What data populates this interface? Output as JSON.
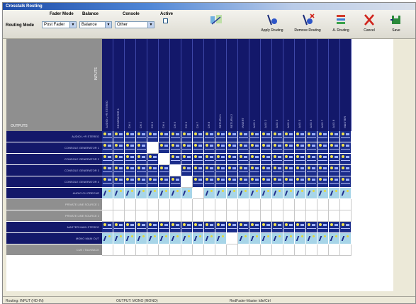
{
  "window": {
    "title": "Crosstalk Routing"
  },
  "toolbar": {
    "routing_mode_label": "Routing Mode",
    "fader_mode_label": "Fader Mode",
    "fader_mode_value": "Post Fader",
    "balance_label": "Balance",
    "balance_value": "Balance",
    "console_label": "Console",
    "console_value": "Other",
    "active_label": "Active",
    "apply_label": "Apply Routing",
    "remove_label": "Remove Routing",
    "arouting_label": "A. Routing",
    "cancel_label": "Cancel",
    "save_label": "Save"
  },
  "grid": {
    "corner_vertical_label": "INPUTS",
    "corner_outputs_label": "OUTPUTS",
    "columns": [
      "AUDIO L+R  STEREO",
      "GENERATOR 1",
      "CH 1",
      "CH 2",
      "CH 3",
      "CH 4",
      "CH 5",
      "CH 6",
      "CH 7",
      "CH 8",
      "RETURN 1",
      "RETURN 2",
      "INSERT",
      "AUX 1",
      "AUX 2",
      "AUX 3",
      "AUX 4",
      "AUX 5",
      "AUX 6",
      "AUX 7",
      "AUX 8",
      "MASTER"
    ],
    "rows": [
      {
        "label": "AUDIO L+R STEREO",
        "style": "dark",
        "cells": [
          "r",
          "r",
          "r",
          "r",
          "r",
          "r",
          "r",
          "r",
          "r",
          "r",
          "r",
          "r",
          "r",
          "r",
          "r",
          "r",
          "r",
          "r",
          "r",
          "r",
          "r",
          "r"
        ]
      },
      {
        "label": "CONSOLE GENERATOR 1",
        "style": "dark",
        "cells": [
          "r",
          "r",
          "r",
          "r",
          "w",
          "r",
          "r",
          "r",
          "r",
          "r",
          "r",
          "r",
          "r",
          "r",
          "r",
          "r",
          "r",
          "r",
          "r",
          "r",
          "r",
          "r"
        ]
      },
      {
        "label": "CONSOLE GENERATOR 2",
        "style": "dark",
        "cells": [
          "r",
          "r",
          "r",
          "r",
          "r",
          "w",
          "r",
          "r",
          "r",
          "r",
          "r",
          "r",
          "r",
          "r",
          "r",
          "r",
          "r",
          "r",
          "r",
          "r",
          "r",
          "r"
        ]
      },
      {
        "label": "CONSOLE GENERATOR 3",
        "style": "dark",
        "cells": [
          "r",
          "r",
          "r",
          "r",
          "r",
          "r",
          "w",
          "r",
          "r",
          "r",
          "r",
          "r",
          "r",
          "r",
          "r",
          "r",
          "r",
          "r",
          "r",
          "r",
          "r",
          "r"
        ]
      },
      {
        "label": "CONSOLE GENERATOR 4",
        "style": "dark",
        "cells": [
          "r",
          "r",
          "r",
          "r",
          "r",
          "r",
          "r",
          "w",
          "r",
          "r",
          "r",
          "r",
          "r",
          "r",
          "r",
          "r",
          "r",
          "r",
          "r",
          "r",
          "r",
          "r"
        ]
      },
      {
        "label": "AUDIO CH PRECUE",
        "style": "dark",
        "cells": [
          "l",
          "l",
          "l",
          "l",
          "l",
          "l",
          "l",
          "l",
          "w",
          "l",
          "l",
          "l",
          "l",
          "l",
          "l",
          "l",
          "l",
          "l",
          "l",
          "l",
          "l",
          "l"
        ]
      },
      {
        "label": "PRIVATE LINE SOURCE 1",
        "style": "gray",
        "cells": [
          "w",
          "w",
          "w",
          "w",
          "w",
          "w",
          "w",
          "w",
          "w",
          "w",
          "w",
          "w",
          "w",
          "w",
          "w",
          "w",
          "w",
          "w",
          "w",
          "w",
          "w",
          "w"
        ]
      },
      {
        "label": "PRIVATE LINE SOURCE 2",
        "style": "gray",
        "cells": [
          "w",
          "w",
          "w",
          "w",
          "w",
          "w",
          "w",
          "w",
          "w",
          "w",
          "w",
          "w",
          "w",
          "w",
          "w",
          "w",
          "w",
          "w",
          "w",
          "w",
          "w",
          "w"
        ]
      },
      {
        "label": "MASTER MAIN STEREO",
        "style": "dark",
        "cells": [
          "r",
          "r",
          "r",
          "r",
          "r",
          "r",
          "r",
          "r",
          "r",
          "r",
          "r",
          "r",
          "r",
          "r",
          "r",
          "r",
          "r",
          "r",
          "r",
          "r",
          "r",
          "r"
        ]
      },
      {
        "label": "MONO MAIN OUT",
        "style": "dark",
        "cells": [
          "l",
          "l",
          "l",
          "l",
          "l",
          "l",
          "l",
          "l",
          "l",
          "l",
          "l",
          "w",
          "l",
          "l",
          "l",
          "l",
          "l",
          "l",
          "l",
          "l",
          "l",
          "l"
        ]
      },
      {
        "label": "CUE / TALKBACK",
        "style": "gray",
        "cells": [
          "w",
          "w",
          "w",
          "w",
          "w",
          "w",
          "w",
          "w",
          "w",
          "w",
          "w",
          "w",
          "w",
          "w",
          "w",
          "w",
          "w",
          "w",
          "w",
          "w",
          "w",
          "w"
        ]
      }
    ]
  },
  "status": {
    "left": "Routing: INPUT (HD-IN)",
    "mid": "OUTPUT: MONO (MONO)",
    "right": "RedFader-Master Idle/Ctrl"
  }
}
